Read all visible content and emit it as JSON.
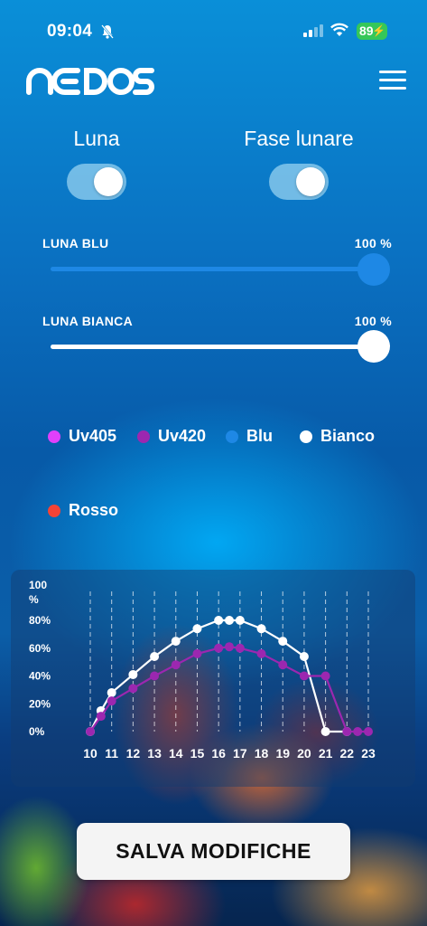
{
  "status_bar": {
    "time": "09:04",
    "battery": "89",
    "icons": [
      "bell-slash-icon",
      "signal-icon",
      "wifi-icon",
      "battery-charging-icon"
    ]
  },
  "header": {
    "logo_text": "NEDOS",
    "menu_icon": "hamburger-menu-icon"
  },
  "toggles": [
    {
      "label": "Luna",
      "on": true
    },
    {
      "label": "Fase lunare",
      "on": true
    }
  ],
  "sliders": [
    {
      "label": "LUNA BLU",
      "value_text": "100 %",
      "value": 100,
      "color": "#1e88e5"
    },
    {
      "label": "LUNA BIANCA",
      "value_text": "100 %",
      "value": 100,
      "color": "#ffffff"
    }
  ],
  "legend": [
    {
      "name": "Uv405",
      "color": "#e040fb"
    },
    {
      "name": "Uv420",
      "color": "#9c27b0"
    },
    {
      "name": "Blu",
      "color": "#1e88e5"
    },
    {
      "name": "Bianco",
      "color": "#ffffff"
    },
    {
      "name": "Rosso",
      "color": "#f44336"
    }
  ],
  "chart_data": {
    "type": "line",
    "ylabel": "100 %",
    "y_ticks": [
      "80%",
      "60%",
      "40%",
      "20%",
      "0%"
    ],
    "ylim": [
      0,
      100
    ],
    "x_ticks": [
      "10",
      "11",
      "12",
      "13",
      "14",
      "15",
      "16",
      "17",
      "18",
      "19",
      "20",
      "21",
      "22",
      "23"
    ],
    "xlim": [
      10,
      23
    ],
    "grid": "vertical dashed",
    "series": [
      {
        "name": "Bianco",
        "color": "#ffffff",
        "x": [
          10,
          10.5,
          11,
          12,
          13,
          14,
          15,
          16,
          16.5,
          17,
          18,
          19,
          20,
          21,
          22
        ],
        "y": [
          0,
          15,
          28,
          41,
          54,
          65,
          74,
          80,
          80,
          80,
          74,
          65,
          54,
          0,
          0
        ]
      },
      {
        "name": "Uv420",
        "color": "#9c27b0",
        "x": [
          10,
          10.5,
          11,
          12,
          13,
          14,
          15,
          16,
          16.5,
          17,
          18,
          19,
          20,
          21,
          22,
          22.5,
          23
        ],
        "y": [
          0,
          11,
          22,
          31,
          40,
          48,
          56,
          60,
          61,
          60,
          56,
          48,
          40,
          40,
          0,
          0,
          0
        ]
      }
    ]
  },
  "save_button": {
    "label": "SALVA MODIFICHE"
  }
}
